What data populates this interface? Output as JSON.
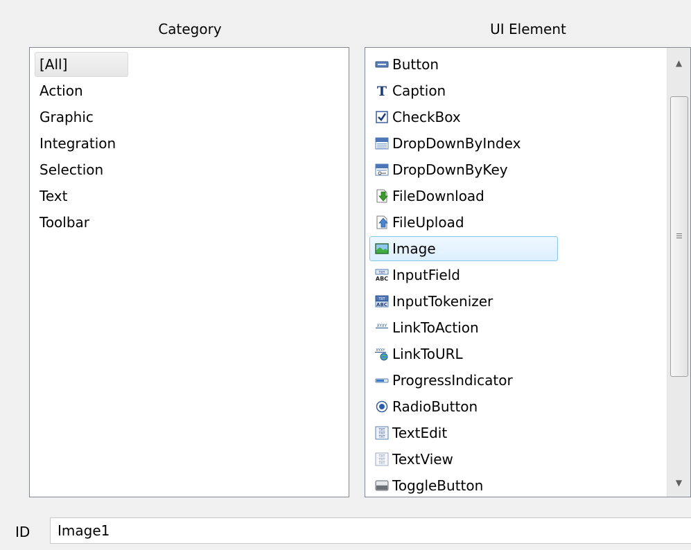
{
  "headers": {
    "category": "Category",
    "ui_element": "UI Element"
  },
  "category_list": {
    "selected": "[All]",
    "items": [
      "[All]",
      "Action",
      "Graphic",
      "Integration",
      "Selection",
      "Text",
      "Toolbar"
    ]
  },
  "ui_element_list": {
    "selected": "Image",
    "items": [
      {
        "label": "Button",
        "icon": "button-icon"
      },
      {
        "label": "Caption",
        "icon": "caption-icon"
      },
      {
        "label": "CheckBox",
        "icon": "checkbox-icon"
      },
      {
        "label": "DropDownByIndex",
        "icon": "dropdown-by-index-icon"
      },
      {
        "label": "DropDownByKey",
        "icon": "dropdown-by-key-icon"
      },
      {
        "label": "FileDownload",
        "icon": "file-download-icon"
      },
      {
        "label": "FileUpload",
        "icon": "file-upload-icon"
      },
      {
        "label": "Image",
        "icon": "image-icon"
      },
      {
        "label": "InputField",
        "icon": "input-field-icon"
      },
      {
        "label": "InputTokenizer",
        "icon": "input-tokenizer-icon"
      },
      {
        "label": "LinkToAction",
        "icon": "link-to-action-icon"
      },
      {
        "label": "LinkToURL",
        "icon": "link-to-url-icon"
      },
      {
        "label": "ProgressIndicator",
        "icon": "progress-indicator-icon"
      },
      {
        "label": "RadioButton",
        "icon": "radio-button-icon"
      },
      {
        "label": "TextEdit",
        "icon": "text-edit-icon"
      },
      {
        "label": "TextView",
        "icon": "text-view-icon"
      },
      {
        "label": "ToggleButton",
        "icon": "toggle-button-icon"
      }
    ]
  },
  "id_field": {
    "label": "ID",
    "value": "Image1"
  },
  "colors": {
    "selection_border": "#84c5ec",
    "selection_fill": "#dcefff",
    "listbox_border": "#828790"
  }
}
